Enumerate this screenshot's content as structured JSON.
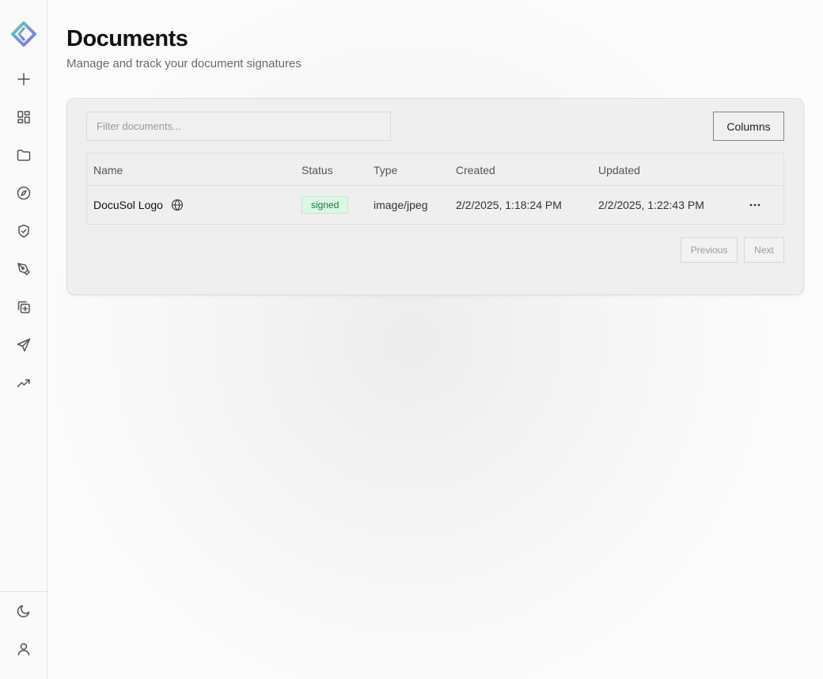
{
  "sidebar": {
    "nav": [
      {
        "icon": "plus-icon"
      },
      {
        "icon": "dashboard-grid-icon"
      },
      {
        "icon": "folder-icon"
      },
      {
        "icon": "compass-icon"
      },
      {
        "icon": "shield-check-icon"
      },
      {
        "icon": "pen-tool-icon"
      },
      {
        "icon": "copy-plus-icon"
      },
      {
        "icon": "send-icon"
      },
      {
        "icon": "trending-up-icon"
      }
    ],
    "bottom": [
      {
        "icon": "moon-icon"
      },
      {
        "icon": "user-icon"
      }
    ],
    "brand_colors": [
      "#5fd0b4",
      "#8b6cf0"
    ]
  },
  "header": {
    "title": "Documents",
    "subtitle": "Manage and track your document signatures"
  },
  "toolbar": {
    "filter_placeholder": "Filter documents...",
    "columns_label": "Columns"
  },
  "table": {
    "headers": {
      "name": "Name",
      "status": "Status",
      "type": "Type",
      "created": "Created",
      "updated": "Updated"
    },
    "rows": [
      {
        "name": "DocuSol Logo",
        "status": "signed",
        "type": "image/jpeg",
        "created": "2/2/2025, 1:18:24 PM",
        "updated": "2/2/2025, 1:22:43 PM"
      }
    ]
  },
  "pagination": {
    "previous_label": "Previous",
    "next_label": "Next"
  },
  "colors": {
    "status_signed_bg": "#dcf7e3",
    "status_signed_text": "#1a7a3a"
  }
}
